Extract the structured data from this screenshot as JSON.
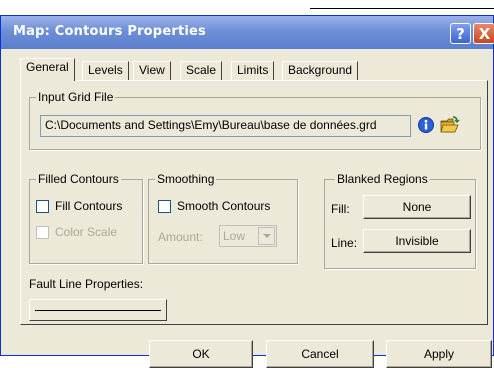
{
  "window": {
    "title": "Map: Contours Properties",
    "help_label": "?",
    "close_label": "X"
  },
  "tabs": [
    {
      "label": "General",
      "active": true
    },
    {
      "label": "Levels"
    },
    {
      "label": "View"
    },
    {
      "label": "Scale"
    },
    {
      "label": "Limits"
    },
    {
      "label": "Background"
    }
  ],
  "input_grid": {
    "label": "Input Grid File",
    "path": "C:\\Documents and Settings\\Emy\\Bureau\\base de données.grd",
    "info_icon": "info-icon",
    "open_icon": "open-folder-icon"
  },
  "filled_contours": {
    "label": "Filled Contours",
    "fill_label": "Fill Contours",
    "color_scale_label": "Color Scale"
  },
  "smoothing": {
    "label": "Smoothing",
    "smooth_label": "Smooth Contours",
    "amount_label": "Amount:",
    "amount_value": "Low"
  },
  "blanked_regions": {
    "label": "Blanked Regions",
    "fill_label": "Fill:",
    "fill_value": "None",
    "line_label": "Line:",
    "line_value": "Invisible"
  },
  "fault_line": {
    "label": "Fault Line Properties:"
  },
  "buttons": {
    "ok": "OK",
    "cancel": "Cancel",
    "apply": "Apply"
  },
  "colors": {
    "titlebar": "#6e8fd6",
    "dialog_bg": "#ece9d8",
    "info_blue": "#2a5fd6",
    "folder_yellow": "#f2c84b"
  }
}
